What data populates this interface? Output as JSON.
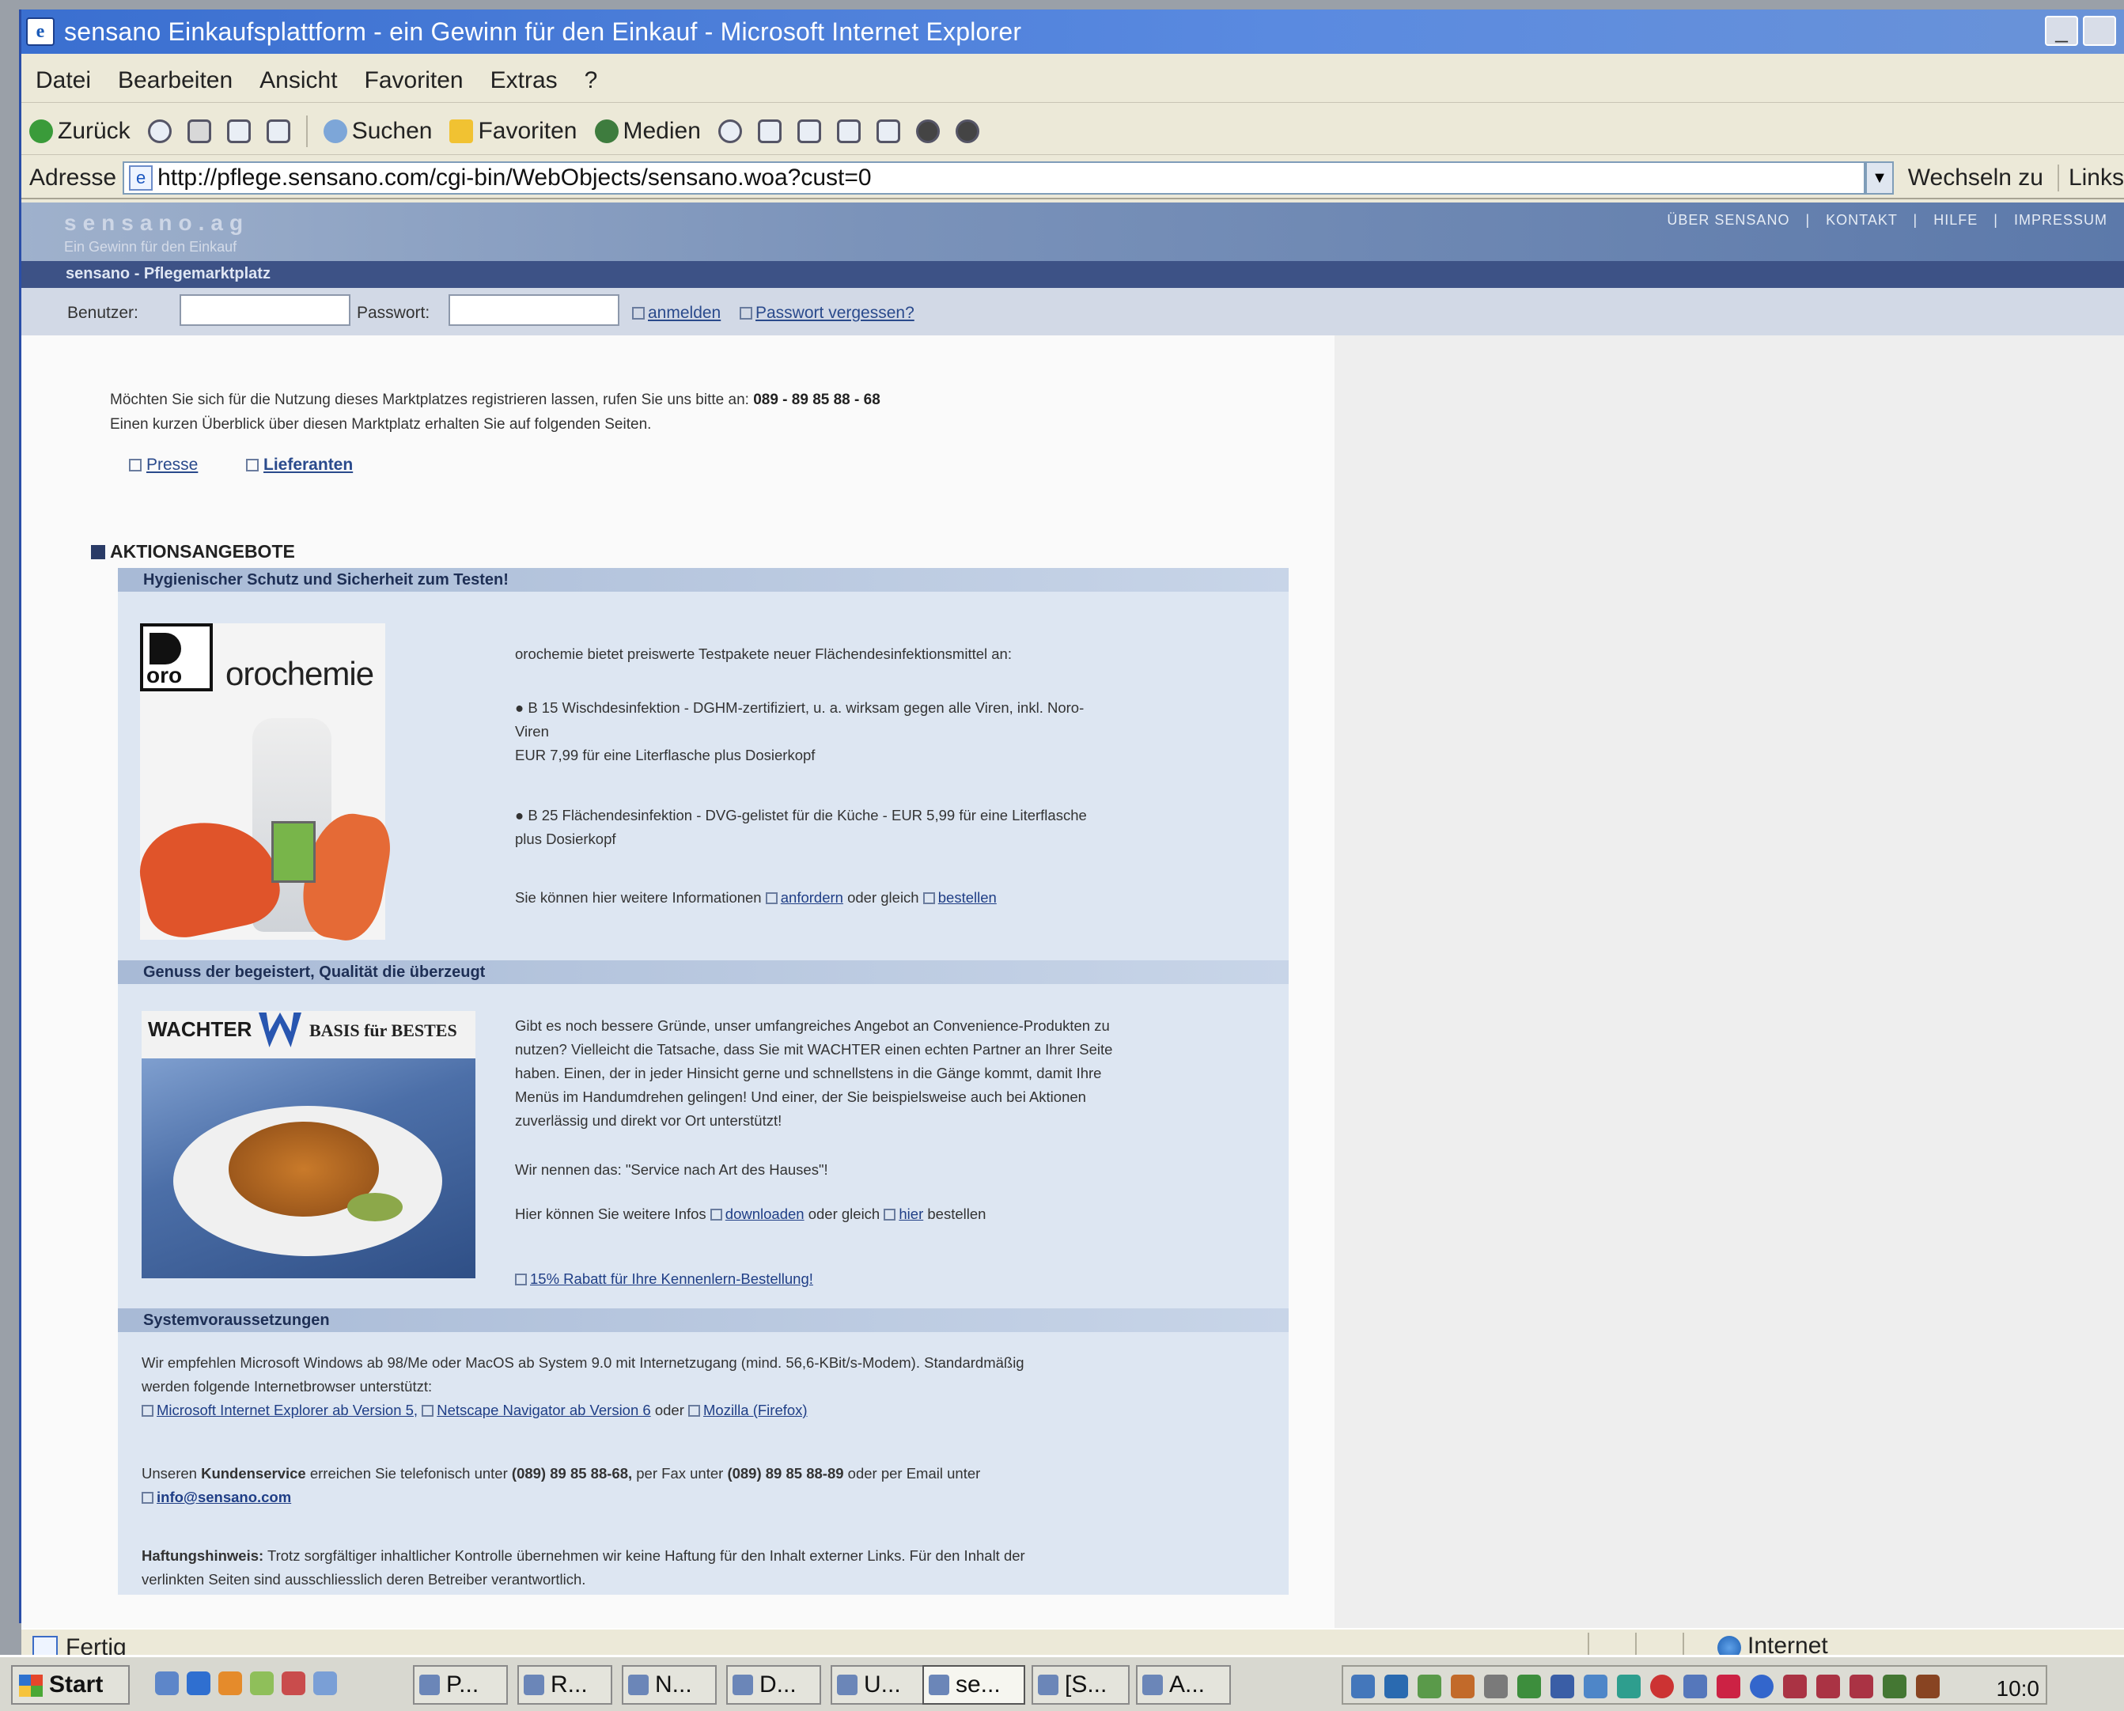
{
  "window": {
    "title": "sensano Einkaufsplattform - ein Gewinn für den Einkauf - Microsoft Internet Explorer",
    "controls": [
      "_",
      " "
    ]
  },
  "menu": [
    "Datei",
    "Bearbeiten",
    "Ansicht",
    "Favoriten",
    "Extras",
    "?"
  ],
  "toolbar": {
    "back": "Zurück",
    "search": "Suchen",
    "favorites": "Favoriten",
    "media": "Medien"
  },
  "address": {
    "label": "Adresse",
    "url": "http://pflege.sensano.com/cgi-bin/WebObjects/sensano.woa?cust=0",
    "go": "Wechseln zu",
    "links": "Links"
  },
  "site": {
    "logo": "sensano.ag",
    "slogan": "Ein Gewinn für den Einkauf",
    "top_links": [
      "ÜBER SENSANO",
      "|",
      "KONTAKT",
      "|",
      "HILFE",
      "|",
      "IMPRESSUM"
    ],
    "subbar_title": "sensano - Pflegemarktplatz",
    "login": {
      "user_label": "Benutzer:",
      "password_label": "Passwort:",
      "login_link": "anmelden",
      "forgot_link": "Passwort vergessen?"
    },
    "intro": {
      "line1": "Möchten Sie sich für die Nutzung dieses Marktplatzes registrieren lassen, rufen Sie uns bitte an:",
      "phone": "089 - 89 85 88 - 68",
      "line2": "Einen kurzen Überblick über diesen Marktplatz erhalten Sie auf folgenden Seiten."
    },
    "nav": [
      "Presse",
      "Lieferanten"
    ],
    "section_title": "AKTIONSANGEBOTE",
    "offer1": {
      "band": "Hygienischer Schutz und Sicherheit zum Testen!",
      "brand_mark": "oro",
      "brand_name": "orochemie",
      "intro": "orochemie bietet preiswerte Testpakete neuer Flächendesinfektionsmittel an:",
      "bullet1_a": "B 15 Wischdesinfektion - DGHM-zertifiziert, u. a. wirksam gegen alle Viren, inkl. Noro-",
      "bullet1_b": "Viren",
      "bullet1_c": "EUR 7,99 für eine Literflasche plus Dosierkopf",
      "bullet2_a": "B 25 Flächendesinfektion - DVG-gelistet für die Küche - EUR 5,99 für eine Literflasche",
      "bullet2_b": "plus Dosierkopf",
      "more_pre": "Sie können hier weitere Informationen",
      "more_link1": "anfordern",
      "more_mid": "oder gleich",
      "more_link2": "bestellen"
    },
    "offer2": {
      "band": "Genuss der begeistert, Qualität die überzeugt",
      "logo_text": "WACHTER",
      "logo_claim": "BASIS für BESTES",
      "p1": "Gibt es noch bessere Gründe, unser umfangreiches Angebot an Convenience-Produkten zu",
      "p2": "nutzen? Vielleicht die Tatsache, dass Sie mit WACHTER einen echten Partner an Ihrer Seite",
      "p3": "haben. Einen, der in jeder Hinsicht gerne und schnellstens in die Gänge kommt, damit Ihre",
      "p4": "Menüs im Handumdrehen gelingen! Und einer, der Sie beispielsweise auch bei Aktionen",
      "p5": "zuverlässig und direkt vor Ort unterstützt!",
      "service": "Wir nennen das: \"Service nach Art des Hauses\"!",
      "more_pre": "Hier können Sie weitere Infos",
      "more_link1": "downloaden",
      "more_mid": "oder gleich",
      "more_link2": "hier",
      "more_post": "bestellen",
      "discount": "15% Rabatt für Ihre Kennenlern-Bestellung!"
    },
    "system": {
      "band": "Systemvoraussetzungen",
      "p1": "Wir empfehlen Microsoft Windows ab 98/Me oder MacOS ab System 9.0 mit Internetzugang (mind. 56,6-KBit/s-Modem). Standardmäßig",
      "p2": "werden folgende Internetbrowser unterstützt:",
      "browser1": "Microsoft Internet Explorer ab Version 5,",
      "browser2": "Netscape Navigator ab Version 6",
      "or": "oder",
      "browser3": "Mozilla (Firefox)",
      "cs_pre": "Unseren",
      "cs_bold": "Kundenservice",
      "cs_mid1": "erreichen Sie telefonisch unter",
      "cs_phone": "(089) 89 85 88-68,",
      "cs_mid2": "per Fax unter",
      "cs_fax": "(089) 89 85 88-89",
      "cs_mid3": "oder per Email unter",
      "cs_email": "info@sensano.com",
      "liab_bold": "Haftungshinweis:",
      "liab_1": "Trotz sorgfältiger inhaltlicher Kontrolle übernehmen wir keine Haftung für den Inhalt externer Links. Für den Inhalt der",
      "liab_2": "verlinkten Seiten sind ausschliesslich deren Betreiber verantwortlich."
    }
  },
  "statusbar": {
    "status": "Fertig",
    "zone": "Internet"
  },
  "taskbar": {
    "start": "Start",
    "tasks": [
      "P...",
      "R...",
      "N...",
      "D...",
      "U...",
      "se...",
      "[S...",
      "A..."
    ],
    "clock": "10:0"
  },
  "colors": {
    "title_bar": "#3a6fd0",
    "site_header": "#5c79aa",
    "site_subbar": "#3d5286",
    "offer_bg": "#dde6f2",
    "link": "#1f3e86"
  }
}
